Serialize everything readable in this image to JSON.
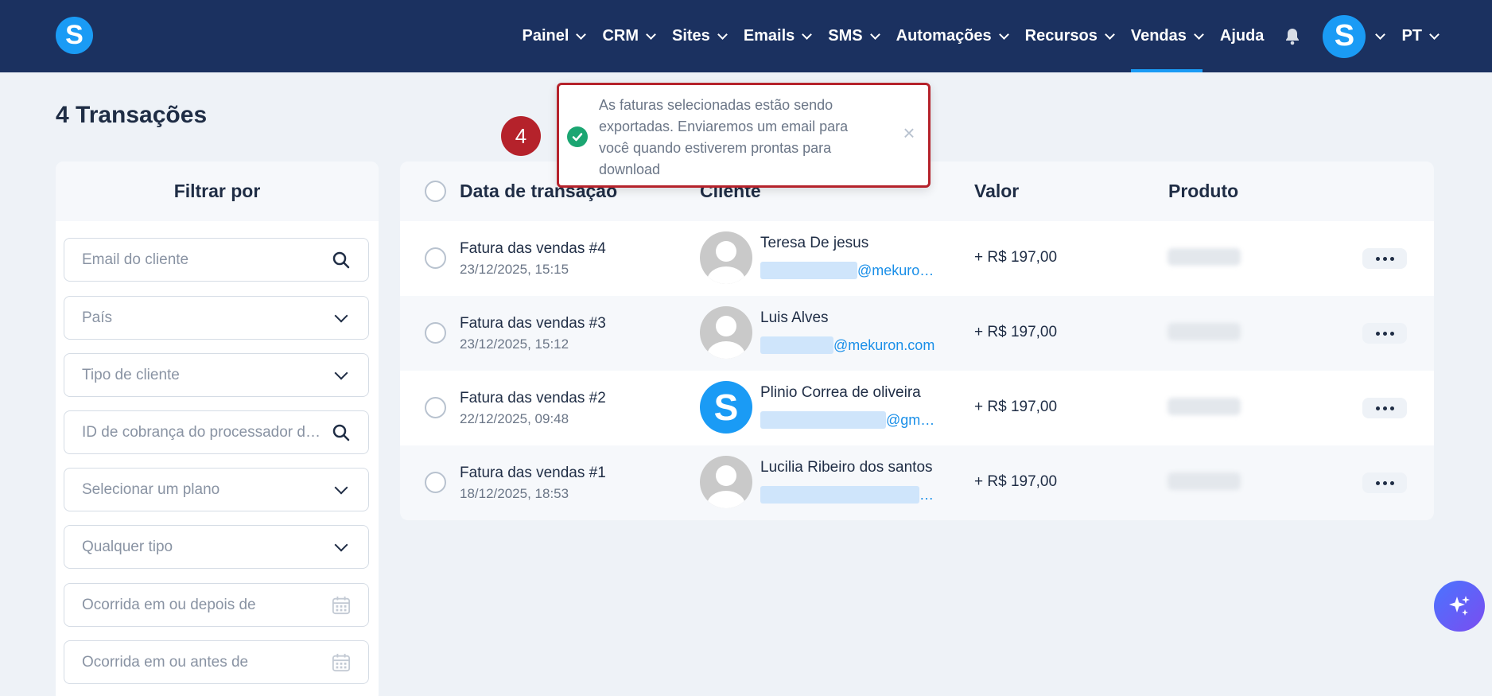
{
  "app": {
    "logo_letter": "S"
  },
  "nav": {
    "items": [
      {
        "label": "Painel",
        "has_menu": true
      },
      {
        "label": "CRM",
        "has_menu": true
      },
      {
        "label": "Sites",
        "has_menu": true
      },
      {
        "label": "Emails",
        "has_menu": true
      },
      {
        "label": "SMS",
        "has_menu": true
      },
      {
        "label": "Automações",
        "has_menu": true
      },
      {
        "label": "Recursos",
        "has_menu": true
      },
      {
        "label": "Vendas",
        "has_menu": true,
        "active": true
      },
      {
        "label": "Ajuda",
        "has_menu": false
      }
    ],
    "avatar_letter": "S",
    "language": "PT"
  },
  "page": {
    "title": "4 Transações"
  },
  "filters": {
    "heading": "Filtrar por",
    "fields": [
      {
        "placeholder": "Email do cliente",
        "icon": "search-icon"
      },
      {
        "placeholder": "País",
        "icon": "chevron-down-icon"
      },
      {
        "placeholder": "Tipo de cliente",
        "icon": "chevron-down-icon"
      },
      {
        "placeholder": "ID de cobrança do processador de pagamento",
        "icon": "search-icon"
      },
      {
        "placeholder": "Selecionar um plano",
        "icon": "chevron-down-icon"
      },
      {
        "placeholder": "Qualquer tipo",
        "icon": "chevron-down-icon"
      },
      {
        "placeholder": "Ocorrida em ou depois de",
        "icon": "calendar-icon"
      },
      {
        "placeholder": "Ocorrida em ou antes de",
        "icon": "calendar-icon"
      }
    ]
  },
  "table": {
    "columns": [
      "Data de transação",
      "Cliente",
      "Valor",
      "Produto"
    ],
    "rows": [
      {
        "title": "Fatura das vendas #4",
        "date": "23/12/2025, 15:15",
        "customer": "Teresa De jesus",
        "email_visible": "@mekuro…",
        "value": "+ R$ 197,00",
        "avatar": "default"
      },
      {
        "title": "Fatura das vendas #3",
        "date": "23/12/2025, 15:12",
        "customer": "Luis Alves",
        "email_visible": "@mekuron.com",
        "value": "+ R$ 197,00",
        "avatar": "default"
      },
      {
        "title": "Fatura das vendas #2",
        "date": "22/12/2025, 09:48",
        "customer": "Plinio Correa de oliveira",
        "email_visible": "@gm…",
        "value": "+ R$ 197,00",
        "avatar": "brand"
      },
      {
        "title": "Fatura das vendas #1",
        "date": "18/12/2025, 18:53",
        "customer": "Lucilia Ribeiro dos santos",
        "email_visible": "…",
        "value": "+ R$ 197,00",
        "avatar": "default"
      }
    ]
  },
  "toast": {
    "message": "As faturas selecionadas estão sendo exportadas. Enviaremos um email para você quando estiverem prontas para download",
    "close": "×"
  },
  "step_badge": "4",
  "colors": {
    "navbar": "#1b3160",
    "accent": "#1a9bf5",
    "highlight": "#b5222b",
    "success": "#1ba672"
  }
}
